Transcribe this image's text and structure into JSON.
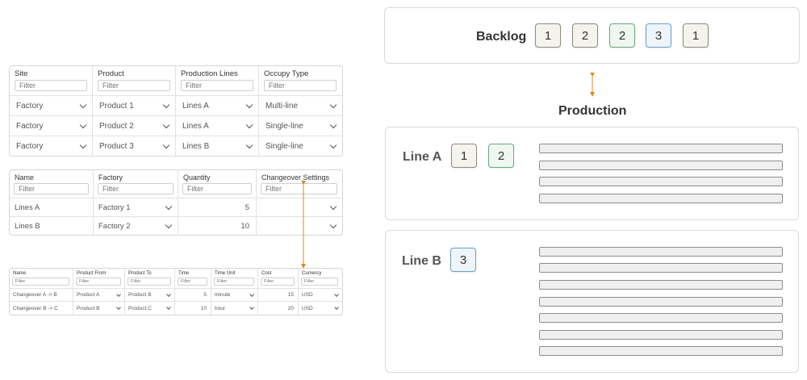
{
  "table1": {
    "headers": [
      "Site",
      "Product",
      "Production Lines",
      "Occupy Type"
    ],
    "filter_placeholder": "Filter",
    "rows": [
      [
        "Factory",
        "Product 1",
        "Lines A",
        "Multi-line"
      ],
      [
        "Factory",
        "Product 2",
        "Lines A",
        "Single-line"
      ],
      [
        "Factory",
        "Product 3",
        "Lines B",
        "Single-line"
      ]
    ]
  },
  "table2": {
    "headers": [
      "Name",
      "Factory",
      "Quantity",
      "Changeover Settings"
    ],
    "filter_placeholder": "Filter",
    "rows": [
      [
        "Lines A",
        "Factory 1",
        "5",
        ""
      ],
      [
        "Lines B",
        "Factory 2",
        "10",
        ""
      ]
    ]
  },
  "table3": {
    "headers": [
      "Name",
      "Product From",
      "Product To",
      "Time",
      "Time Unit",
      "Cost",
      "Currency"
    ],
    "filter_placeholder": "Filter",
    "rows": [
      [
        "Changeover A -> B",
        "Product A",
        "Product B",
        "5",
        "minute",
        "15",
        "USD"
      ],
      [
        "Changeover B -> C",
        "Product B",
        "Product C",
        "10",
        "hour",
        "20",
        "USD"
      ]
    ]
  },
  "backlog": {
    "label": "Backlog",
    "chips": [
      {
        "value": "1",
        "color": "neutral"
      },
      {
        "value": "2",
        "color": "neutral"
      },
      {
        "value": "2",
        "color": "green"
      },
      {
        "value": "3",
        "color": "blue"
      },
      {
        "value": "1",
        "color": "neutral"
      }
    ]
  },
  "production": {
    "label": "Production",
    "lines": [
      {
        "label": "Line A",
        "chips": [
          {
            "value": "1",
            "color": "neutral"
          },
          {
            "value": "2",
            "color": "green"
          }
        ],
        "slot_count": 4
      },
      {
        "label": "Line B",
        "chips": [
          {
            "value": "3",
            "color": "blue"
          }
        ],
        "slot_count": 7
      }
    ]
  },
  "colors": {
    "neutral_chip": "#f5f3ee",
    "green_chip": "#eef7f0",
    "blue_chip": "#edf5fb",
    "connector": "#d98a2b"
  }
}
